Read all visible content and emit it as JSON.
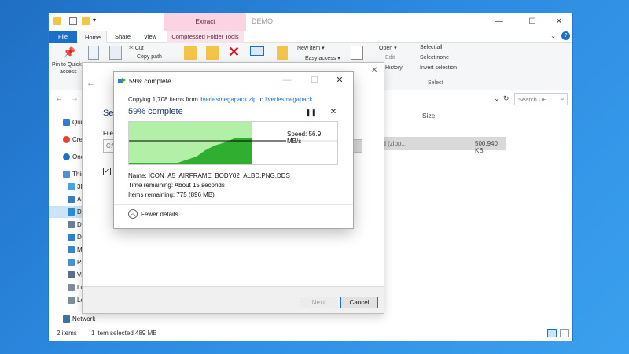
{
  "explorer": {
    "window_title": "DEMO",
    "context_tab": "Extract",
    "tabs": [
      {
        "label": "File"
      },
      {
        "label": "Home"
      },
      {
        "label": "Share"
      },
      {
        "label": "View"
      },
      {
        "label": "Compressed Folder Tools"
      }
    ],
    "ribbon": {
      "pin_label": "Pin to Quick",
      "pin_label2": "access",
      "cut": "Cut",
      "copy_path": "Copy path",
      "new_item": "New item ▾",
      "easy_access": "Easy access ▾",
      "open": "Open ▾",
      "edit": "Edit",
      "history": "History",
      "select_all": "Select all",
      "select_none": "Select none",
      "invert_selection": "Invert selection",
      "select_group": "Select"
    },
    "search_placeholder": "Search DE...",
    "nav": [
      {
        "label": "Qui",
        "icon": "star-icon",
        "color": "#2d7fd3"
      },
      {
        "label": "Cre",
        "icon": "creative-cloud-icon",
        "color": "#e5432d"
      },
      {
        "label": "One",
        "icon": "onedrive-icon",
        "color": "#1a73c7"
      },
      {
        "label": "This",
        "icon": "computer-icon",
        "color": "#4a90d9"
      },
      {
        "label": "3D",
        "icon": "3d-objects-icon",
        "color": "#4aa3df"
      },
      {
        "label": "Ap",
        "icon": "apps-icon",
        "color": "#3a7fc4"
      },
      {
        "label": "De",
        "icon": "desktop-folder-icon",
        "color": "#2b8ad8"
      },
      {
        "label": "Do",
        "icon": "documents-icon",
        "color": "#6b7f95"
      },
      {
        "label": "Do",
        "icon": "downloads-icon",
        "color": "#2d7fd3"
      },
      {
        "label": "M",
        "icon": "music-icon",
        "color": "#3a85d0"
      },
      {
        "label": "Pi",
        "icon": "pictures-icon",
        "color": "#4a90d9"
      },
      {
        "label": "Vi",
        "icon": "videos-icon",
        "color": "#5a6f8a"
      },
      {
        "label": "Lo",
        "icon": "local-disk-icon",
        "color": "#7f8c99"
      },
      {
        "label": "Lo",
        "icon": "local-disk-icon",
        "color": "#7f8c99"
      },
      {
        "label": "Network",
        "icon": "network-icon",
        "color": "#3a6fb0"
      }
    ],
    "columns": {
      "type_partial": "er",
      "size": "Size"
    },
    "row": {
      "type": "ssed (zipp...",
      "size": "500,940 KB"
    },
    "status": {
      "items": "2 items",
      "selected": "1 item selected  489 MB"
    }
  },
  "wizard": {
    "heading": "Sel",
    "files_label": "Files",
    "path_partial": "C:\\",
    "checkbox_label": "S",
    "next": "Next",
    "cancel": "Cancel"
  },
  "progress": {
    "title": "59% complete",
    "copying_prefix": "Copying 1,708 items from ",
    "source": "liveriesmegapack.zip",
    "to_word": " to ",
    "destination": "liveriesmegapack",
    "heading": "59% complete",
    "percent": 59,
    "speed": "Speed: 56.9 MB/s",
    "name": "Name: ICON_A5_AIRFRAME_BODY02_ALBD.PNG.DDS",
    "time_remaining": "Time remaining: About 15 seconds",
    "items_remaining": "Items remaining: 775 (896 MB)",
    "fewer_details": "Fewer details",
    "colors": {
      "fill": "#b3f0a7",
      "area": "#2fae2f",
      "line": "#000000"
    }
  }
}
